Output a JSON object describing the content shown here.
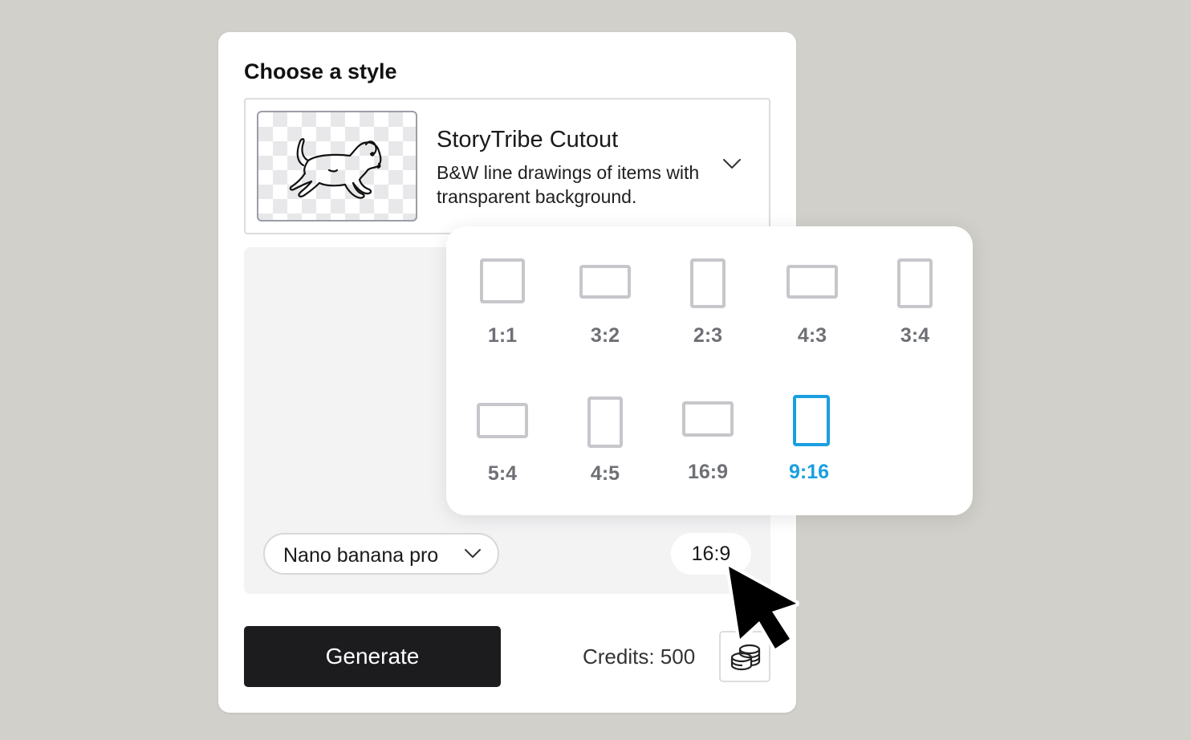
{
  "style_panel": {
    "title": "Choose a style",
    "selected_style": {
      "name": "StoryTribe Cutout",
      "description": "B&W line drawings of items with transparent background."
    }
  },
  "prompt_area": {
    "model_selector": {
      "label": "Nano banana pro"
    },
    "aspect_ratio_button": {
      "label": "16:9"
    }
  },
  "aspect_ratio_popup": {
    "options": [
      {
        "label": "1:1"
      },
      {
        "label": "3:2"
      },
      {
        "label": "2:3"
      },
      {
        "label": "4:3"
      },
      {
        "label": "3:4"
      },
      {
        "label": "5:4"
      },
      {
        "label": "4:5"
      },
      {
        "label": "16:9"
      },
      {
        "label": "9:16"
      }
    ],
    "selected": "9:16",
    "accent_color": "#1a9fe0"
  },
  "footer": {
    "generate_label": "Generate",
    "credits_label": "Credits: 500"
  },
  "icons": [
    "dog-illustration",
    "chevron-down-icon",
    "coins-stack-icon",
    "mouse-pointer-icon"
  ]
}
